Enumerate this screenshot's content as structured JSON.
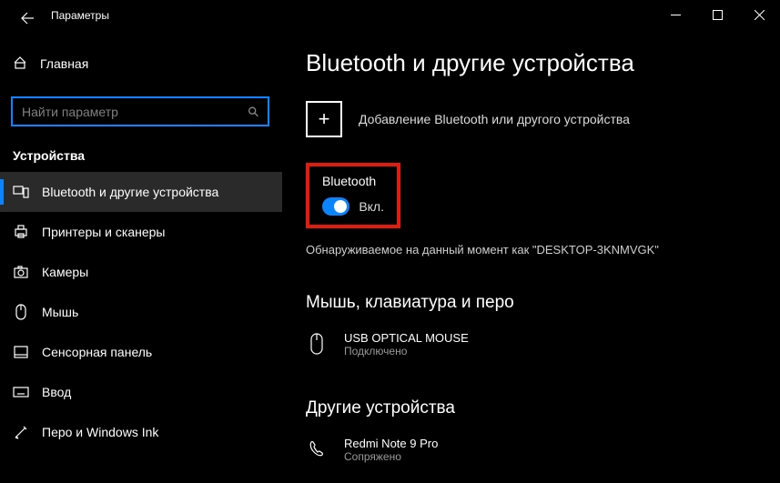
{
  "window": {
    "title": "Параметры"
  },
  "sidebar": {
    "home": "Главная",
    "search_placeholder": "Найти параметр",
    "section": "Устройства",
    "items": [
      {
        "label": "Bluetooth и другие устройства"
      },
      {
        "label": "Принтеры и сканеры"
      },
      {
        "label": "Камеры"
      },
      {
        "label": "Мышь"
      },
      {
        "label": "Сенсорная панель"
      },
      {
        "label": "Ввод"
      },
      {
        "label": "Перо и Windows Ink"
      }
    ]
  },
  "content": {
    "title": "Bluetooth и другие устройства",
    "add_label": "Добавление Bluetooth или другого устройства",
    "bt_section_title": "Bluetooth",
    "bt_toggle_state": "Вкл.",
    "discoverable": "Обнаруживаемое на данный момент как \"DESKTOP-3KNMVGK\"",
    "mouse_header": "Мышь, клавиатура и перо",
    "mouse_device": {
      "name": "USB OPTICAL MOUSE",
      "status": "Подключено"
    },
    "other_header": "Другие устройства",
    "other_device": {
      "name": "Redmi Note 9 Pro",
      "status": "Сопряжено"
    }
  }
}
